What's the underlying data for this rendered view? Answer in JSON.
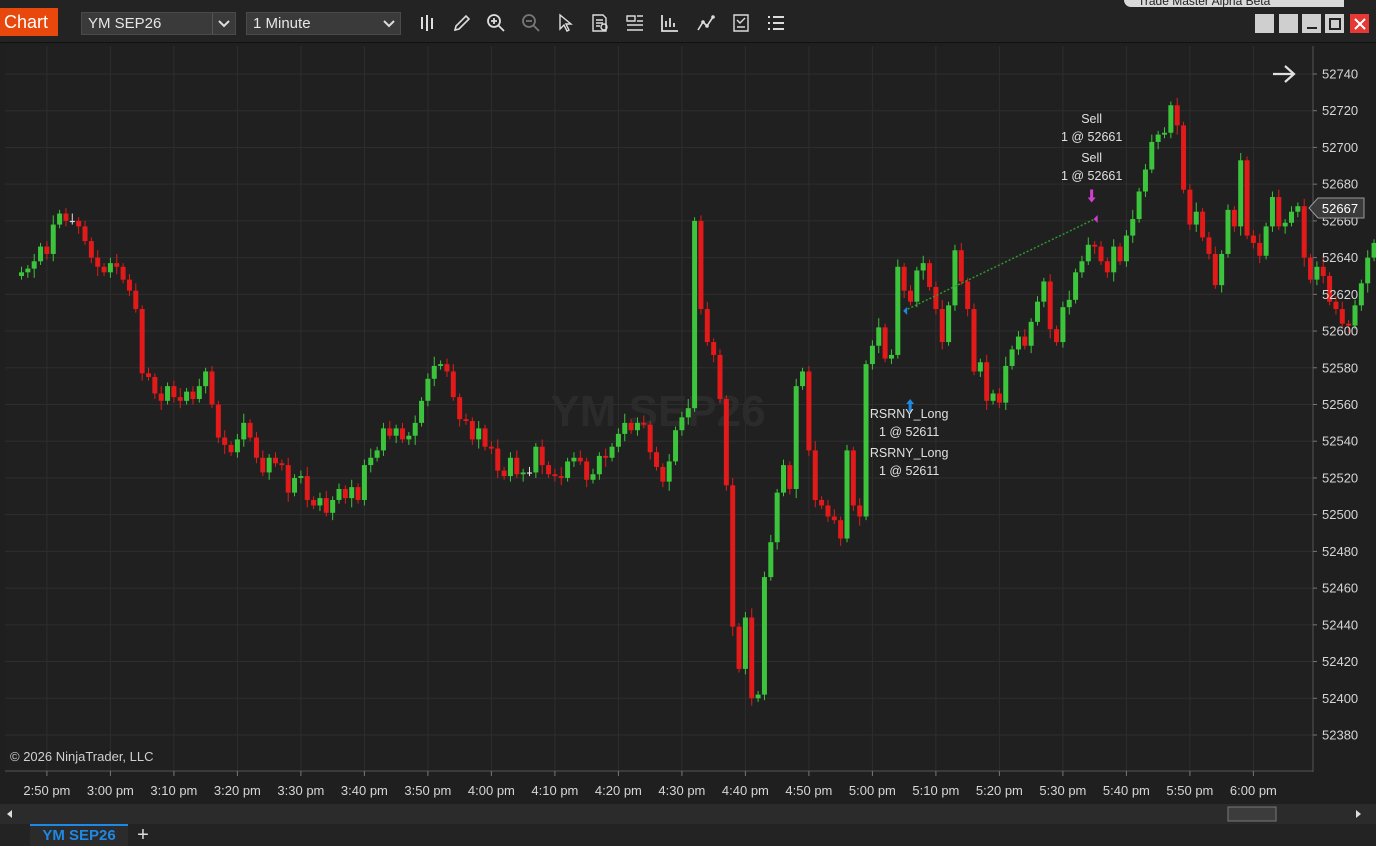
{
  "toolbar": {
    "chart_tab_label": "Chart",
    "instrument": "YM SEP26",
    "interval": "1 Minute",
    "tools": [
      "bar-type-icon",
      "pencil-icon",
      "zoom-in-icon",
      "zoom-out-icon",
      "pointer-icon",
      "data-box-icon",
      "properties-icon",
      "indicators-icon",
      "strategies-icon",
      "templates-icon",
      "list-icon"
    ],
    "accent_color": "#e8480c"
  },
  "window": {
    "title": "Trade Master Alpha Beta"
  },
  "chart": {
    "watermark": "YM SEP26",
    "copyright": "© 2026 NinjaTrader, LLC",
    "current_price": "52667",
    "colors": {
      "up": "#3cc43c",
      "down": "#e31a1a",
      "background": "#202020",
      "grid": "#2e2e2e"
    }
  },
  "chart_data": {
    "type": "candlestick",
    "instrument": "YM SEP26",
    "interval": "1 Minute",
    "ylim": [
      52370,
      52750
    ],
    "y_ticks": [
      52380,
      52400,
      52420,
      52440,
      52460,
      52480,
      52500,
      52520,
      52540,
      52560,
      52580,
      52600,
      52620,
      52640,
      52660,
      52680,
      52700,
      52720,
      52740
    ],
    "x_ticks": [
      "2:50 pm",
      "3:00 pm",
      "3:10 pm",
      "3:20 pm",
      "3:30 pm",
      "3:40 pm",
      "3:50 pm",
      "4:00 pm",
      "4:10 pm",
      "4:20 pm",
      "4:30 pm",
      "4:40 pm",
      "4:50 pm",
      "5:00 pm",
      "5:10 pm",
      "5:20 pm",
      "5:30 pm",
      "5:40 pm",
      "5:50 pm",
      "6:00 pm"
    ],
    "first_bar_time": "2:46 pm",
    "grid": true,
    "last_price": 52667,
    "closes": [
      52632,
      52634,
      52638,
      52646,
      52642,
      52658,
      52664,
      52660,
      52660,
      52657,
      52649,
      52640,
      52635,
      52632,
      52637,
      52635,
      52628,
      52622,
      52612,
      52577,
      52575,
      52566,
      52562,
      52570,
      52564,
      52562,
      52567,
      52563,
      52570,
      52578,
      52560,
      52542,
      52538,
      52534,
      52541,
      52550,
      52542,
      52531,
      52523,
      52531,
      52528,
      52527,
      52512,
      52520,
      52521,
      52508,
      52505,
      52509,
      52501,
      52508,
      52514,
      52509,
      52515,
      52508,
      52527,
      52531,
      52535,
      52547,
      52543,
      52547,
      52541,
      52543,
      52550,
      52562,
      52574,
      52581,
      52582,
      52578,
      52564,
      52552,
      52551,
      52541,
      52547,
      52537,
      52536,
      52524,
      52521,
      52531,
      52522,
      52523,
      52523,
      52537,
      52527,
      52522,
      52521,
      52520,
      52529,
      52531,
      52529,
      52519,
      52522,
      52532,
      52531,
      52537,
      52544,
      52550,
      52546,
      52550,
      52549,
      52534,
      52526,
      52518,
      52529,
      52546,
      52553,
      52558,
      52660,
      52612,
      52594,
      52587,
      52563,
      52516,
      52439,
      52416,
      52444,
      52400,
      52402,
      52466,
      52485,
      52512,
      52527,
      52514,
      52570,
      52578,
      52535,
      52508,
      52505,
      52499,
      52497,
      52487,
      52535,
      52505,
      52499,
      52582,
      52592,
      52602,
      52585,
      52587,
      52635,
      52622,
      52616,
      52633,
      52637,
      52624,
      52612,
      52594,
      52614,
      52644,
      52627,
      52612,
      52578,
      52583,
      52562,
      52566,
      52561,
      52581,
      52590,
      52597,
      52592,
      52605,
      52616,
      52627,
      52601,
      52594,
      52613,
      52617,
      52632,
      52638,
      52647,
      52646,
      52638,
      52632,
      52646,
      52638,
      52652,
      52661,
      52676,
      52688,
      52703,
      52707,
      52708,
      52723,
      52712,
      52677,
      52658,
      52665,
      52651,
      52642,
      52625,
      52642,
      52666,
      52657,
      52693,
      52652,
      52648,
      52641,
      52657,
      52673,
      52657,
      52659,
      52665,
      52668,
      52640,
      52628,
      52635,
      52630,
      52616,
      52612,
      52604,
      52603,
      52614,
      52626,
      52640,
      52648,
      52667
    ]
  },
  "annotations": {
    "sell_label_1": "Sell",
    "sell_detail_1": "1 @ 52661",
    "sell_label_2": "Sell",
    "sell_detail_2": "1 @ 52661",
    "long_label_1": "RSRNY_Long",
    "long_detail_1": "1 @ 52611",
    "long_label_2": "RSRNY_Long",
    "long_detail_2": "1 @ 52611"
  },
  "bottom": {
    "tab_label": "YM SEP26",
    "add_tab": "+"
  }
}
